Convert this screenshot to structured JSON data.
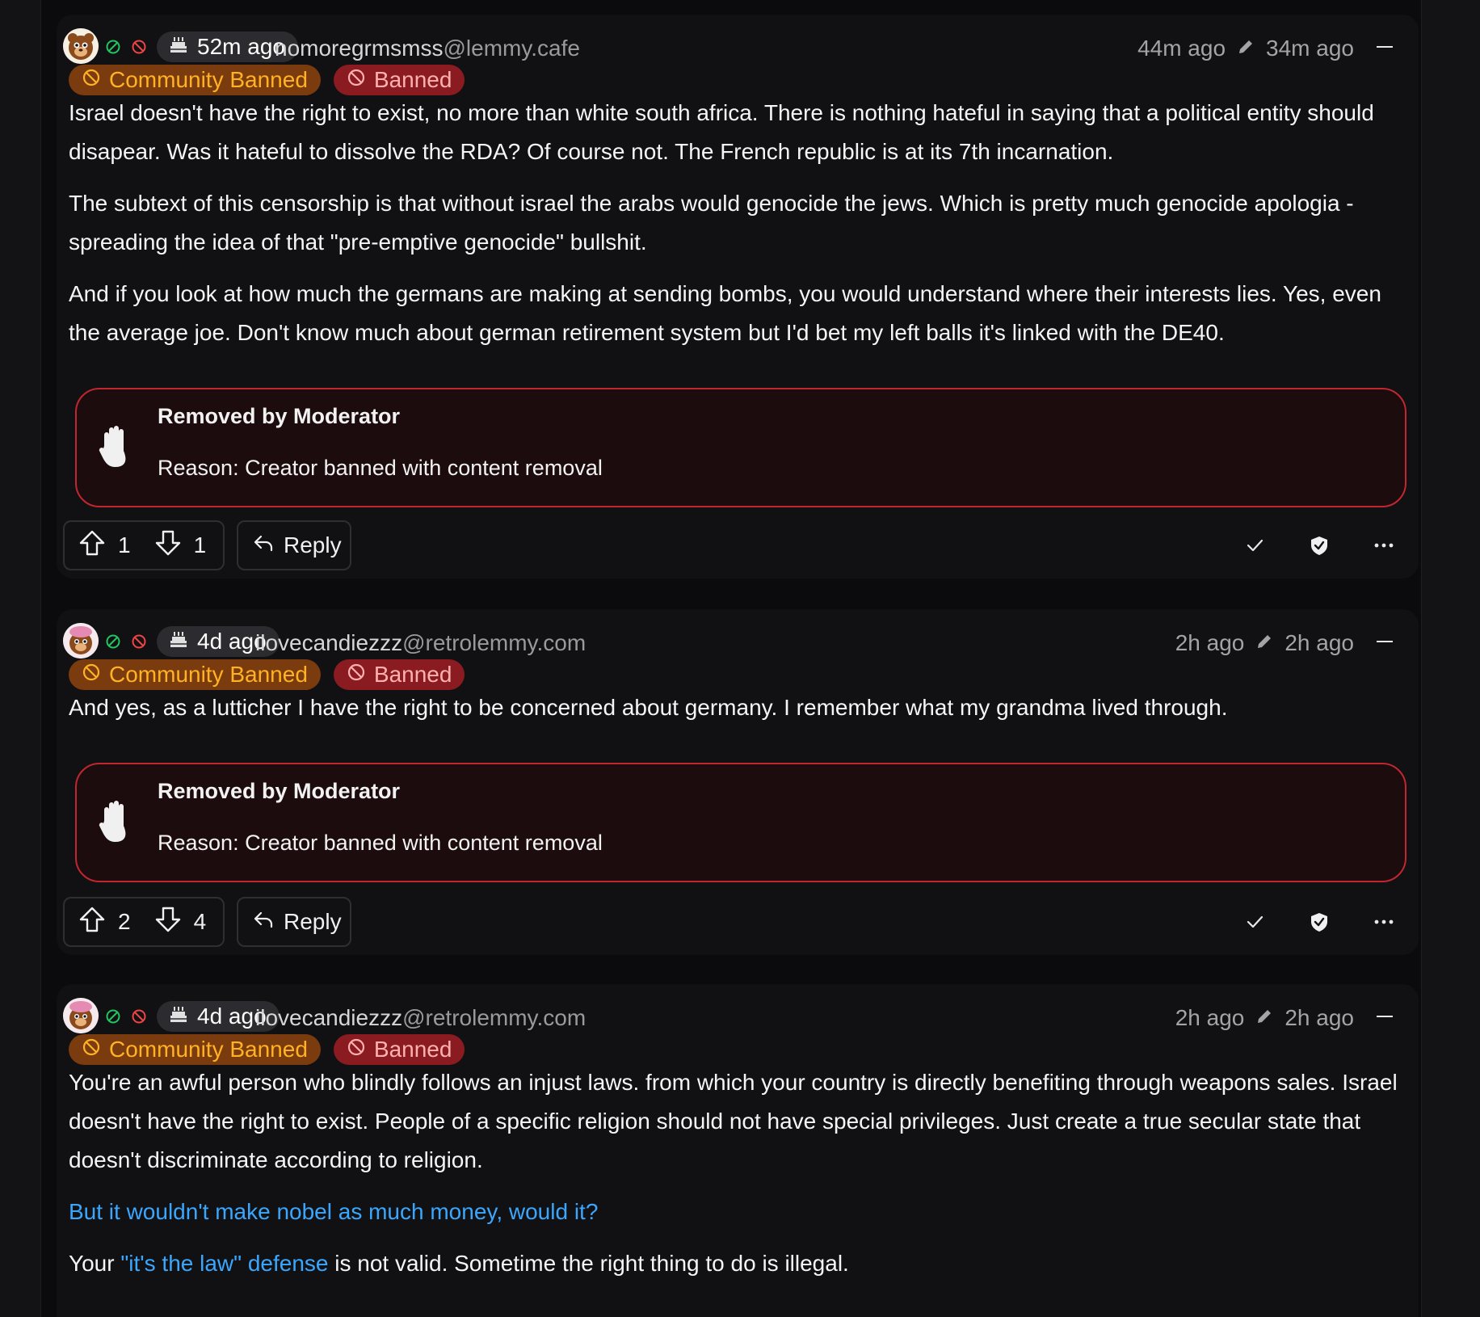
{
  "colors": {
    "background": "#0b0b0d",
    "card": "#111114",
    "community_banned_bg": "#7a3b0f",
    "community_banned_fg": "#ffb224",
    "banned_bg": "#8a1b21",
    "banned_fg": "#ffb0b0",
    "removed_border": "#c2262f",
    "link": "#3aa7ff",
    "online": "#22c55e"
  },
  "comments": [
    {
      "account_age": "52m ago",
      "username": "nomoregrmsmss",
      "instance": "@lemmy.cafe",
      "published": "44m ago",
      "edited": "34m ago",
      "badges": [
        "Community Banned",
        "Banned"
      ],
      "paragraphs": [
        "Israel doesn't have the right to exist, no more than white south africa. There is nothing hateful in saying that a political entity should disapear. Was it hateful to dissolve the RDA? Of course not. The French republic is at its 7th incarnation.",
        "The subtext of this censorship is that without israel the arabs would genocide the jews. Which is pretty much genocide apologia - spreading the idea of that \"pre-emptive genocide\" bullshit.",
        "And if you look at how much the germans are making at sending bombs, you would understand where their interests lies. Yes, even the average joe. Don't know much about german retirement system but I'd bet my left balls it's linked with the DE40."
      ],
      "removed_title": "Removed by Moderator",
      "removed_reason_label": "Reason:",
      "removed_reason": "Creator banned with content removal",
      "upvotes": "1",
      "downvotes": "1",
      "reply_label": "Reply"
    },
    {
      "account_age": "4d ago",
      "username": "ilovecandiezzz",
      "instance": "@retrolemmy.com",
      "published": "2h ago",
      "edited": "2h ago",
      "badges": [
        "Community Banned",
        "Banned"
      ],
      "paragraphs": [
        "And yes, as a lutticher I have the right to be concerned about germany. I remember what my grandma lived through."
      ],
      "removed_title": "Removed by Moderator",
      "removed_reason_label": "Reason:",
      "removed_reason": "Creator banned with content removal",
      "upvotes": "2",
      "downvotes": "4",
      "reply_label": "Reply"
    },
    {
      "account_age": "4d ago",
      "username": "ilovecandiezzz",
      "instance": "@retrolemmy.com",
      "published": "2h ago",
      "edited": "2h ago",
      "badges": [
        "Community Banned",
        "Banned"
      ],
      "paragraphs": [
        "You're an awful person who blindly follows an injust laws. from which your country is directly benefiting through weapons sales. Israel doesn't have the right to exist. People of a specific religion should not have special privileges. Just create a true secular state that doesn't discriminate according to religion."
      ],
      "link_paragraph": "But it wouldn't make nobel as much money, would it?",
      "mixed_paragraph": {
        "prefix": "Your ",
        "link": "\"it's the law\" defense",
        "suffix": " is not valid. Sometime the right thing to do is illegal."
      }
    }
  ],
  "icons": [
    "avatar",
    "online-icon",
    "ban-icon",
    "cake-icon",
    "edit-pencil-icon",
    "collapse-icon",
    "hand-stop-icon",
    "arrow-up-icon",
    "arrow-down-icon",
    "reply-icon",
    "check-icon",
    "shield-icon",
    "more-icon"
  ]
}
